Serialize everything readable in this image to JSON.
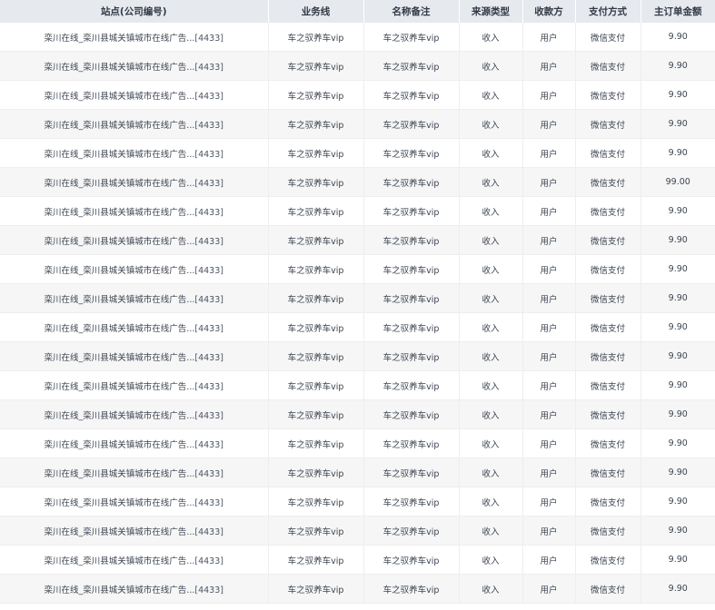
{
  "table": {
    "headers": [
      "站点(公司编号)",
      "业务线",
      "名称备注",
      "来源类型",
      "收款方",
      "支付方式",
      "主订单金额"
    ],
    "rows": [
      {
        "site": "栾川在线_栾川县城关镇城市在线广告...",
        "code": "[4433]",
        "business_line": "车之驭养车vip",
        "name_note": "车之驭养车vip",
        "source_type": "收入",
        "payee": "用户",
        "payment_method": "微信支付",
        "amount": "9.90"
      },
      {
        "site": "栾川在线_栾川县城关镇城市在线广告...",
        "code": "[4433]",
        "business_line": "车之驭养车vip",
        "name_note": "车之驭养车vip",
        "source_type": "收入",
        "payee": "用户",
        "payment_method": "微信支付",
        "amount": "9.90"
      },
      {
        "site": "栾川在线_栾川县城关镇城市在线广告...",
        "code": "[4433]",
        "business_line": "车之驭养车vip",
        "name_note": "车之驭养车vip",
        "source_type": "收入",
        "payee": "用户",
        "payment_method": "微信支付",
        "amount": "9.90"
      },
      {
        "site": "栾川在线_栾川县城关镇城市在线广告...",
        "code": "[4433]",
        "business_line": "车之驭养车vip",
        "name_note": "车之驭养车vip",
        "source_type": "收入",
        "payee": "用户",
        "payment_method": "微信支付",
        "amount": "9.90"
      },
      {
        "site": "栾川在线_栾川县城关镇城市在线广告...",
        "code": "[4433]",
        "business_line": "车之驭养车vip",
        "name_note": "车之驭养车vip",
        "source_type": "收入",
        "payee": "用户",
        "payment_method": "微信支付",
        "amount": "9.90"
      },
      {
        "site": "栾川在线_栾川县城关镇城市在线广告...",
        "code": "[4433]",
        "business_line": "车之驭养车vip",
        "name_note": "车之驭养车vip",
        "source_type": "收入",
        "payee": "用户",
        "payment_method": "微信支付",
        "amount": "99.00"
      },
      {
        "site": "栾川在线_栾川县城关镇城市在线广告...",
        "code": "[4433]",
        "business_line": "车之驭养车vip",
        "name_note": "车之驭养车vip",
        "source_type": "收入",
        "payee": "用户",
        "payment_method": "微信支付",
        "amount": "9.90"
      },
      {
        "site": "栾川在线_栾川县城关镇城市在线广告...",
        "code": "[4433]",
        "business_line": "车之驭养车vip",
        "name_note": "车之驭养车vip",
        "source_type": "收入",
        "payee": "用户",
        "payment_method": "微信支付",
        "amount": "9.90"
      },
      {
        "site": "栾川在线_栾川县城关镇城市在线广告...",
        "code": "[4433]",
        "business_line": "车之驭养车vip",
        "name_note": "车之驭养车vip",
        "source_type": "收入",
        "payee": "用户",
        "payment_method": "微信支付",
        "amount": "9.90"
      },
      {
        "site": "栾川在线_栾川县城关镇城市在线广告...",
        "code": "[4433]",
        "business_line": "车之驭养车vip",
        "name_note": "车之驭养车vip",
        "source_type": "收入",
        "payee": "用户",
        "payment_method": "微信支付",
        "amount": "9.90"
      },
      {
        "site": "栾川在线_栾川县城关镇城市在线广告...",
        "code": "[4433]",
        "business_line": "车之驭养车vip",
        "name_note": "车之驭养车vip",
        "source_type": "收入",
        "payee": "用户",
        "payment_method": "微信支付",
        "amount": "9.90"
      },
      {
        "site": "栾川在线_栾川县城关镇城市在线广告...",
        "code": "[4433]",
        "business_line": "车之驭养车vip",
        "name_note": "车之驭养车vip",
        "source_type": "收入",
        "payee": "用户",
        "payment_method": "微信支付",
        "amount": "9.90"
      },
      {
        "site": "栾川在线_栾川县城关镇城市在线广告...",
        "code": "[4433]",
        "business_line": "车之驭养车vip",
        "name_note": "车之驭养车vip",
        "source_type": "收入",
        "payee": "用户",
        "payment_method": "微信支付",
        "amount": "9.90"
      },
      {
        "site": "栾川在线_栾川县城关镇城市在线广告...",
        "code": "[4433]",
        "business_line": "车之驭养车vip",
        "name_note": "车之驭养车vip",
        "source_type": "收入",
        "payee": "用户",
        "payment_method": "微信支付",
        "amount": "9.90"
      },
      {
        "site": "栾川在线_栾川县城关镇城市在线广告...",
        "code": "[4433]",
        "business_line": "车之驭养车vip",
        "name_note": "车之驭养车vip",
        "source_type": "收入",
        "payee": "用户",
        "payment_method": "微信支付",
        "amount": "9.90"
      },
      {
        "site": "栾川在线_栾川县城关镇城市在线广告...",
        "code": "[4433]",
        "business_line": "车之驭养车vip",
        "name_note": "车之驭养车vip",
        "source_type": "收入",
        "payee": "用户",
        "payment_method": "微信支付",
        "amount": "9.90"
      },
      {
        "site": "栾川在线_栾川县城关镇城市在线广告...",
        "code": "[4433]",
        "business_line": "车之驭养车vip",
        "name_note": "车之驭养车vip",
        "source_type": "收入",
        "payee": "用户",
        "payment_method": "微信支付",
        "amount": "9.90"
      },
      {
        "site": "栾川在线_栾川县城关镇城市在线广告...",
        "code": "[4433]",
        "business_line": "车之驭养车vip",
        "name_note": "车之驭养车vip",
        "source_type": "收入",
        "payee": "用户",
        "payment_method": "微信支付",
        "amount": "9.90"
      },
      {
        "site": "栾川在线_栾川县城关镇城市在线广告...",
        "code": "[4433]",
        "business_line": "车之驭养车vip",
        "name_note": "车之驭养车vip",
        "source_type": "收入",
        "payee": "用户",
        "payment_method": "微信支付",
        "amount": "9.90"
      },
      {
        "site": "栾川在线_栾川县城关镇城市在线广告...",
        "code": "[4433]",
        "business_line": "车之驭养车vip",
        "name_note": "车之驭养车vip",
        "source_type": "收入",
        "payee": "用户",
        "payment_method": "微信支付",
        "amount": "9.90"
      }
    ]
  },
  "colors": {
    "header_bg": "#e6e9ee",
    "stripe_bg": "#f6f6f6",
    "text": "#3c4450"
  }
}
